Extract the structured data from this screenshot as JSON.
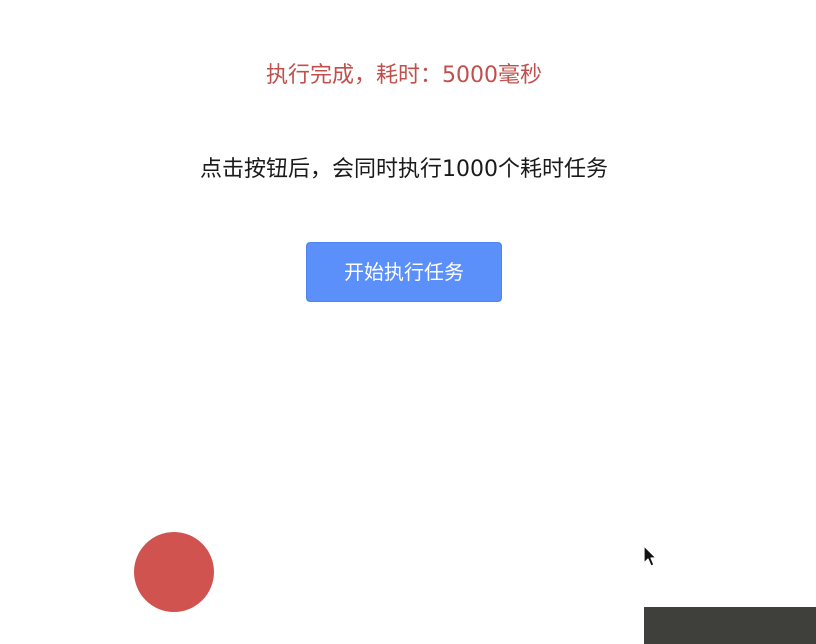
{
  "status": {
    "text": "执行完成，耗时：5000毫秒",
    "color": "#c0504d"
  },
  "description": {
    "text": "点击按钮后，会同时执行1000个耗时任务"
  },
  "start_button": {
    "label": "开始执行任务",
    "color": "#5b8ff9"
  },
  "animation": {
    "ball_color": "#d05350"
  },
  "icons": {
    "cursor": "mouse-pointer-icon"
  }
}
